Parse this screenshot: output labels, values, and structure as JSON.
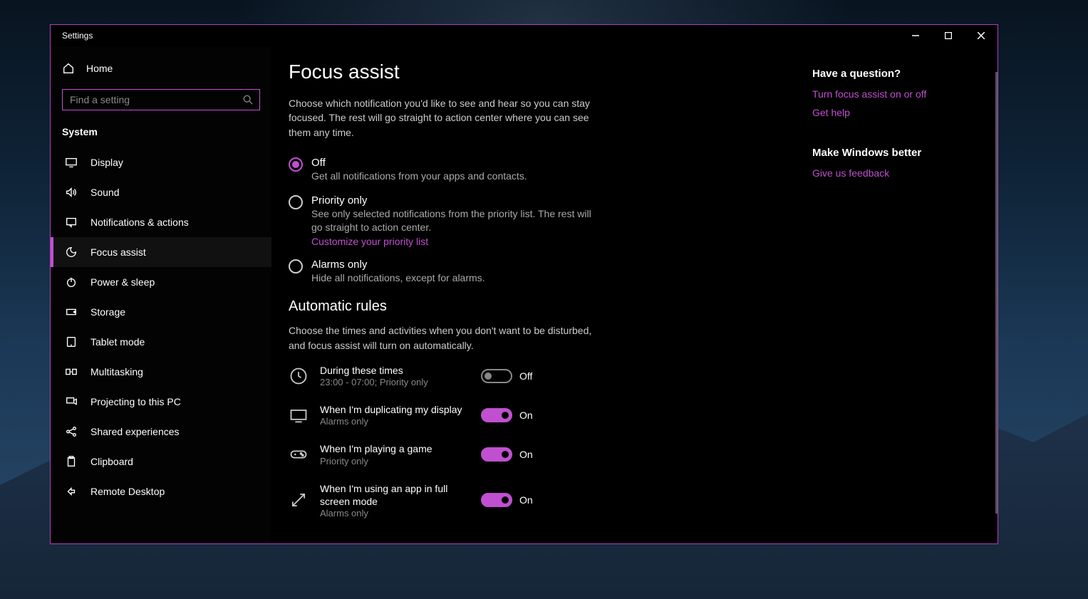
{
  "window": {
    "title": "Settings"
  },
  "sidebar": {
    "home_label": "Home",
    "search_placeholder": "Find a setting",
    "category": "System",
    "items": [
      {
        "label": "Display"
      },
      {
        "label": "Sound"
      },
      {
        "label": "Notifications & actions"
      },
      {
        "label": "Focus assist"
      },
      {
        "label": "Power & sleep"
      },
      {
        "label": "Storage"
      },
      {
        "label": "Tablet mode"
      },
      {
        "label": "Multitasking"
      },
      {
        "label": "Projecting to this PC"
      },
      {
        "label": "Shared experiences"
      },
      {
        "label": "Clipboard"
      },
      {
        "label": "Remote Desktop"
      }
    ]
  },
  "main": {
    "title": "Focus assist",
    "description": "Choose which notification you'd like to see and hear so you can stay focused. The rest will go straight to action center where you can see them any time.",
    "radios": {
      "off": {
        "label": "Off",
        "desc": "Get all notifications from your apps and contacts."
      },
      "priority": {
        "label": "Priority only",
        "desc": "See only selected notifications from the priority list. The rest will go straight to action center.",
        "link": "Customize your priority list"
      },
      "alarms": {
        "label": "Alarms only",
        "desc": "Hide all notifications, except for alarms."
      }
    },
    "auto": {
      "title": "Automatic rules",
      "desc": "Choose the times and activities when you don't want to be disturbed, and focus assist will turn on automatically.",
      "rules": [
        {
          "title": "During these times",
          "sub": "23:00 - 07:00; Priority only",
          "state": "Off"
        },
        {
          "title": "When I'm duplicating my display",
          "sub": "Alarms only",
          "state": "On"
        },
        {
          "title": "When I'm playing a game",
          "sub": "Priority only",
          "state": "On"
        },
        {
          "title": "When I'm using an app in full screen mode",
          "sub": "Alarms only",
          "state": "On"
        }
      ]
    }
  },
  "aside": {
    "question_heading": "Have a question?",
    "question_links": [
      "Turn focus assist on or off",
      "Get help"
    ],
    "better_heading": "Make Windows better",
    "better_link": "Give us feedback"
  }
}
